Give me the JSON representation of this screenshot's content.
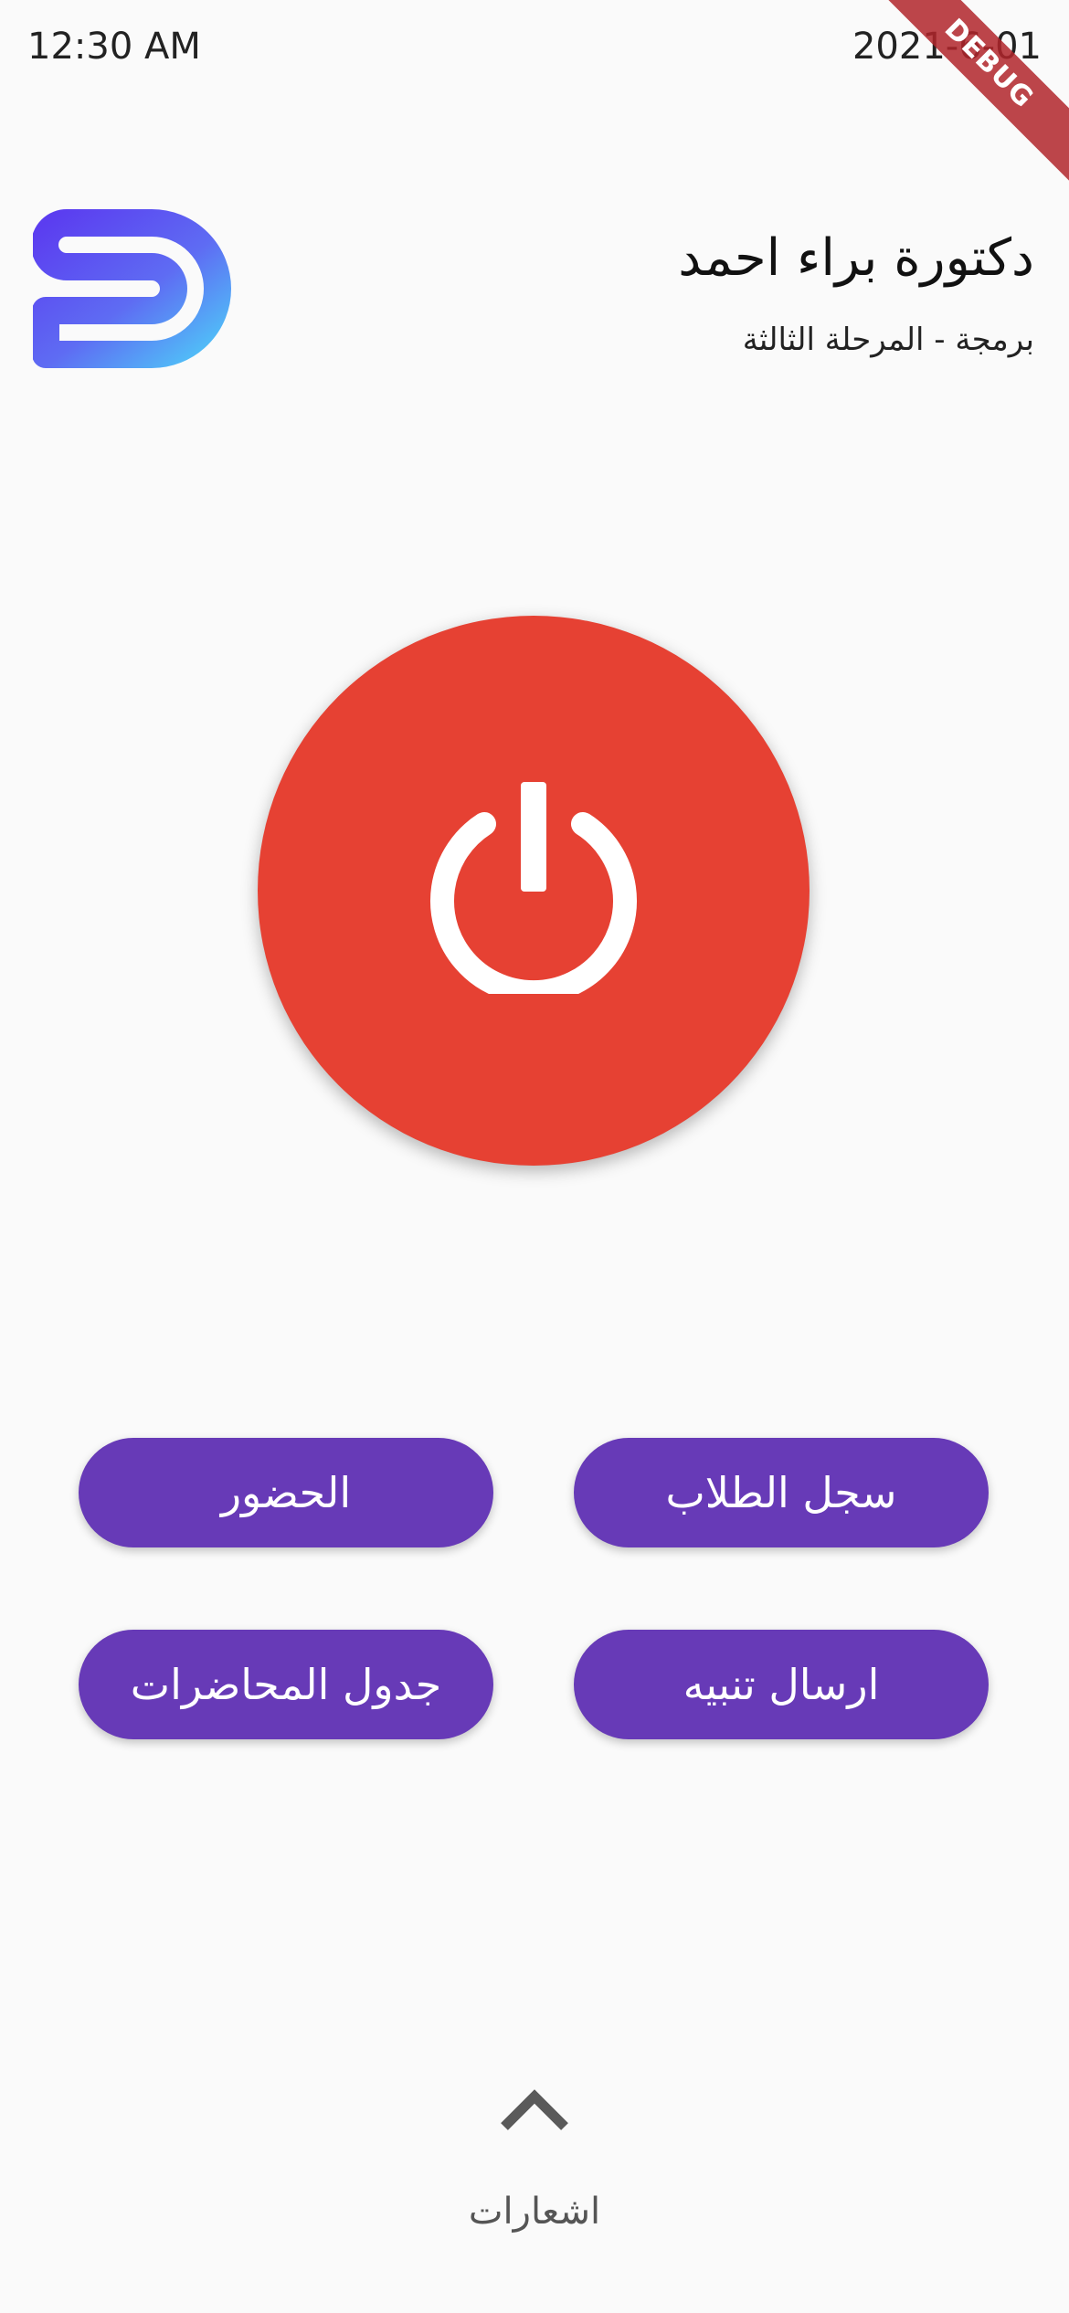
{
  "status_bar": {
    "time": "12:30 AM",
    "date": "2021-6-01"
  },
  "debug_banner": "DEBUG",
  "header": {
    "title": "دكتورة براء احمد",
    "subtitle": "برمجة - المرحلة الثالثة"
  },
  "logo": {
    "icon": "s-brand-logo",
    "gradient_start": "#5b4ef2",
    "gradient_end": "#4fc3f7"
  },
  "power": {
    "icon": "power-icon",
    "color": "#e64133"
  },
  "actions": {
    "student_register": "سجل الطلاب",
    "attendance": "الحضور",
    "send_alert": "ارسال تنبيه",
    "lecture_schedule": "جدول المحاضرات",
    "color": "#673ab7"
  },
  "notifications": {
    "icon": "chevron-up-icon",
    "label": "اشعارات"
  }
}
